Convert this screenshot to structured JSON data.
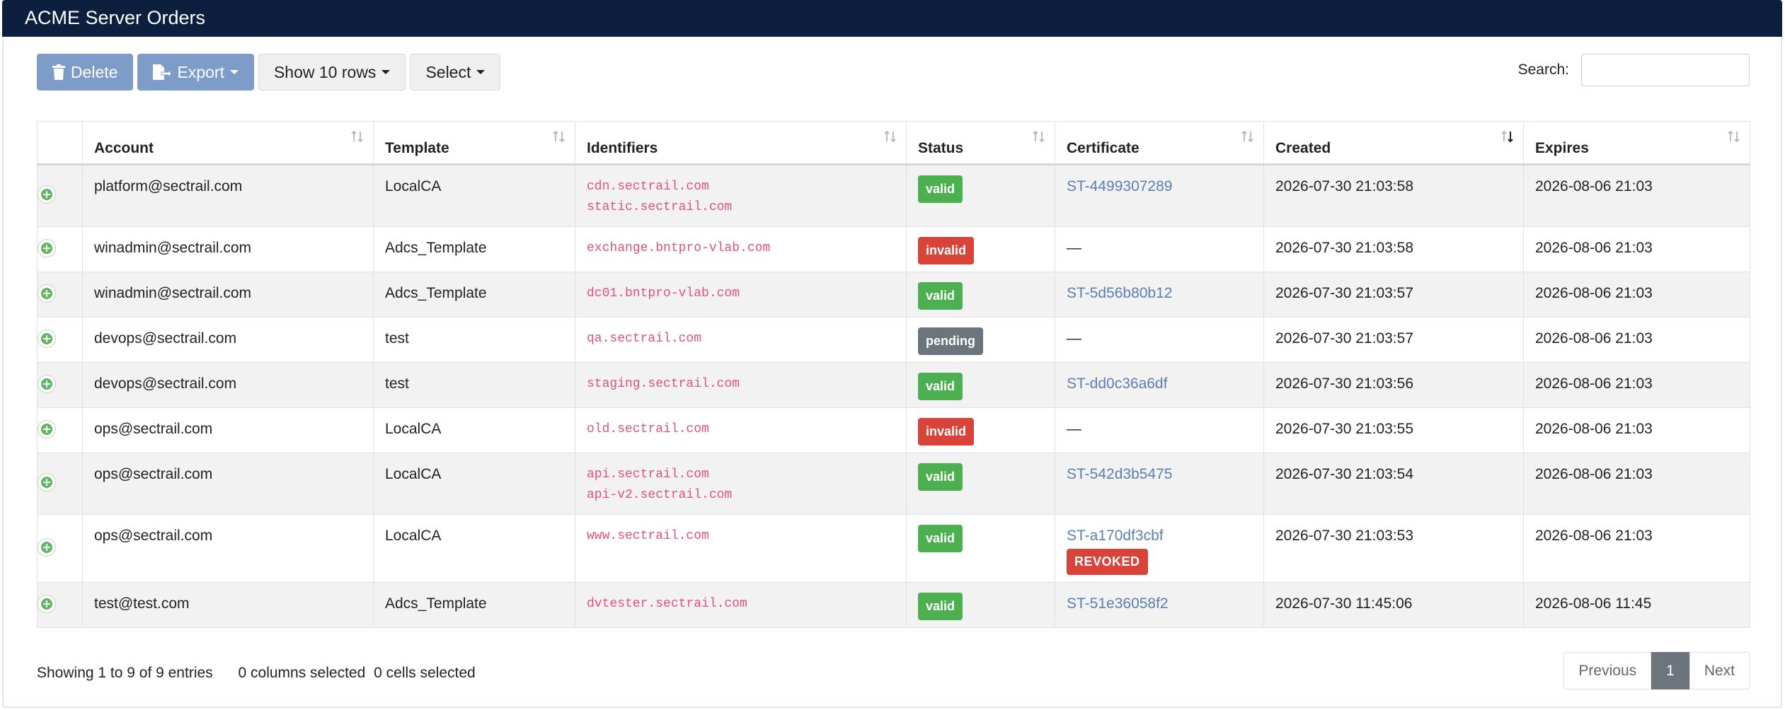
{
  "app": {
    "title": "ACME Server Orders"
  },
  "toolbar": {
    "delete_label": "Delete",
    "export_label": "Export",
    "rows_label": "Show 10 rows",
    "select_label": "Select"
  },
  "search": {
    "label": "Search:",
    "value": "",
    "placeholder": ""
  },
  "columns": [
    "Account",
    "Template",
    "Identifiers",
    "Status",
    "Certificate",
    "Created",
    "Expires"
  ],
  "rows": [
    {
      "account": "platform@sectrail.com",
      "template": "LocalCA",
      "identifiers": [
        "cdn.sectrail.com",
        "static.sectrail.com"
      ],
      "status": "valid",
      "certificate": "ST-4499307289",
      "revoked": "",
      "created": "2026-07-30 21:03:58",
      "expires": "2026-08-06 21:03"
    },
    {
      "account": "winadmin@sectrail.com",
      "template": "Adcs_Template",
      "identifiers": [
        "exchange.bntpro-vlab.com"
      ],
      "status": "invalid",
      "certificate": "—",
      "revoked": "",
      "created": "2026-07-30 21:03:58",
      "expires": "2026-08-06 21:03"
    },
    {
      "account": "winadmin@sectrail.com",
      "template": "Adcs_Template",
      "identifiers": [
        "dc01.bntpro-vlab.com"
      ],
      "status": "valid",
      "certificate": "ST-5d56b80b12",
      "revoked": "",
      "created": "2026-07-30 21:03:57",
      "expires": "2026-08-06 21:03"
    },
    {
      "account": "devops@sectrail.com",
      "template": "test",
      "identifiers": [
        "qa.sectrail.com"
      ],
      "status": "pending",
      "certificate": "—",
      "revoked": "",
      "created": "2026-07-30 21:03:57",
      "expires": "2026-08-06 21:03"
    },
    {
      "account": "devops@sectrail.com",
      "template": "test",
      "identifiers": [
        "staging.sectrail.com"
      ],
      "status": "valid",
      "certificate": "ST-dd0c36a6df",
      "revoked": "",
      "created": "2026-07-30 21:03:56",
      "expires": "2026-08-06 21:03"
    },
    {
      "account": "ops@sectrail.com",
      "template": "LocalCA",
      "identifiers": [
        "old.sectrail.com"
      ],
      "status": "invalid",
      "certificate": "—",
      "revoked": "",
      "created": "2026-07-30 21:03:55",
      "expires": "2026-08-06 21:03"
    },
    {
      "account": "ops@sectrail.com",
      "template": "LocalCA",
      "identifiers": [
        "api.sectrail.com",
        "api-v2.sectrail.com"
      ],
      "status": "valid",
      "certificate": "ST-542d3b5475",
      "revoked": "",
      "created": "2026-07-30 21:03:54",
      "expires": "2026-08-06 21:03"
    },
    {
      "account": "ops@sectrail.com",
      "template": "LocalCA",
      "identifiers": [
        "www.sectrail.com"
      ],
      "status": "valid",
      "certificate": "ST-a170df3cbf",
      "revoked": "REVOKED",
      "created": "2026-07-30 21:03:53",
      "expires": "2026-08-06 21:03"
    },
    {
      "account": "test@test.com",
      "template": "Adcs_Template",
      "identifiers": [
        "dvtester.sectrail.com"
      ],
      "status": "valid",
      "certificate": "ST-51e36058f2",
      "revoked": "",
      "created": "2026-07-30 11:45:06",
      "expires": "2026-08-06 11:45"
    }
  ],
  "footer": {
    "info": "Showing 1 to 9 of 9 entries",
    "columns_selected": "0 columns selected",
    "cells_selected": "0 cells selected"
  },
  "pagination": {
    "previous": "Previous",
    "current": "1",
    "next": "Next"
  },
  "colors": {
    "header_bg": "#0c1f3f",
    "primary": "#7e9cc8",
    "valid": "#4caf50",
    "invalid": "#d9443a",
    "pending": "#6c757d",
    "identifier": "#e0537a",
    "link": "#5a7fb5"
  }
}
